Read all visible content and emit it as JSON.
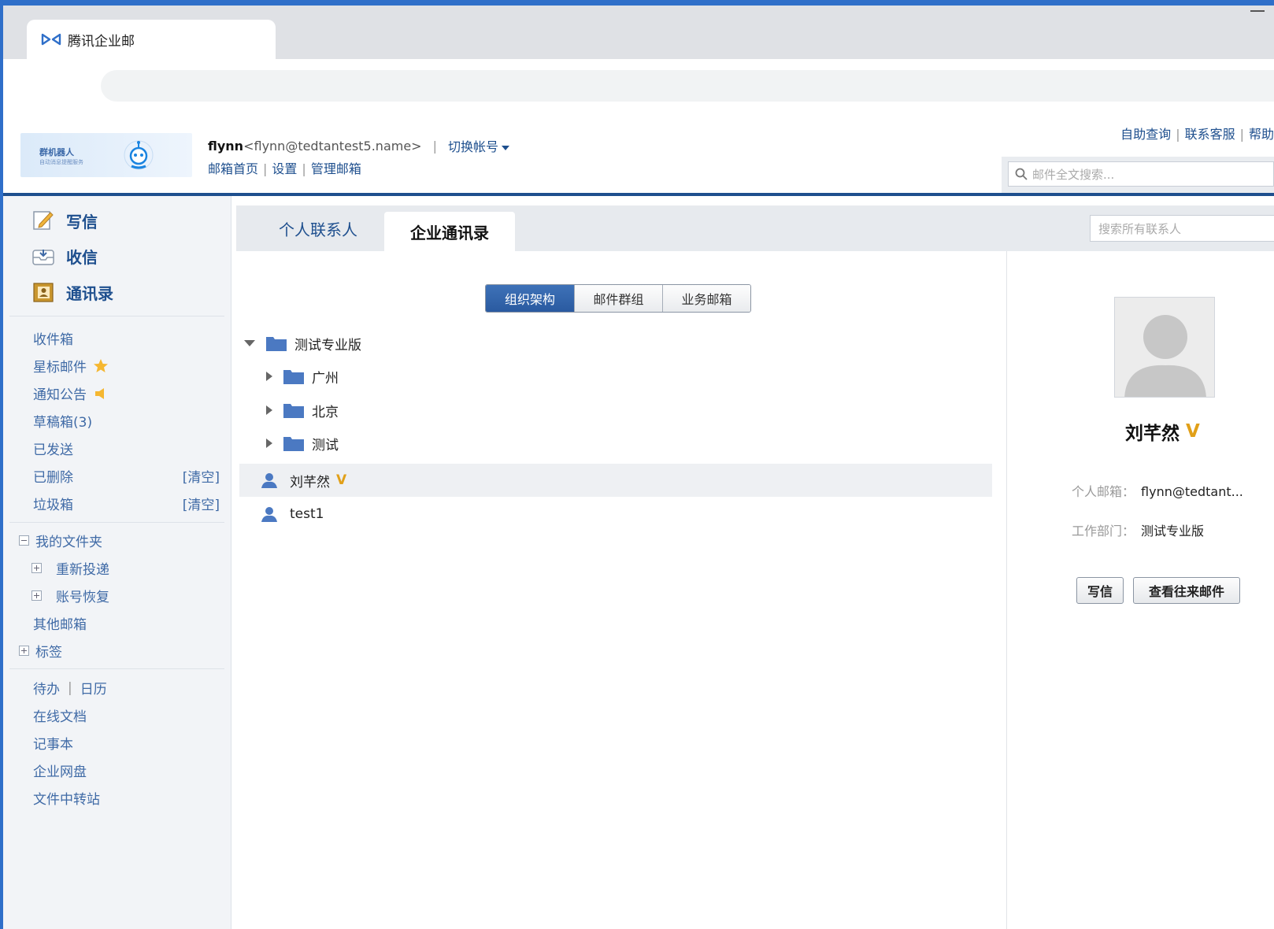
{
  "browser": {
    "tab_title": "腾讯企业邮"
  },
  "header": {
    "banner_title": "群机器人",
    "banner_sub": "自动消息提醒服务",
    "user_name": "flynn",
    "user_email": "<flynn@tedtantest5.name>",
    "separator": "|",
    "switch_account": "切换帐号",
    "links": [
      "邮箱首页",
      "设置",
      "管理邮箱"
    ],
    "top_links": [
      "自助查询",
      "联系客服",
      "帮助"
    ],
    "mail_search_placeholder": "邮件全文搜索..."
  },
  "sidebar": {
    "compose": "写信",
    "inbox_main": "收信",
    "contacts": "通讯录",
    "folders": [
      {
        "label": "收件箱"
      },
      {
        "label": "星标邮件"
      },
      {
        "label": "通知公告"
      },
      {
        "label": "草稿箱(3)"
      },
      {
        "label": "已发送"
      },
      {
        "label": "已删除",
        "extra": "[清空]"
      },
      {
        "label": "垃圾箱",
        "extra": "[清空]"
      }
    ],
    "my_folders": "我的文件夹",
    "my_folder_items": [
      "重新投递",
      "账号恢复"
    ],
    "other_mail": "其他邮箱",
    "tags": "标签",
    "todo": "待办",
    "calendar": "日历",
    "tools": [
      "在线文档",
      "记事本",
      "企业网盘",
      "文件中转站"
    ]
  },
  "main": {
    "tabs": [
      "个人联系人",
      "企业通讯录"
    ],
    "contact_search_placeholder": "搜索所有联系人",
    "segments": [
      "组织架构",
      "邮件群组",
      "业务邮箱"
    ],
    "tree": {
      "root": "测试专业版",
      "folders": [
        "广州",
        "北京",
        "测试"
      ],
      "people": [
        {
          "name": "刘芊然",
          "badge": "V"
        },
        {
          "name": "test1"
        }
      ]
    }
  },
  "detail": {
    "name": "刘芊然",
    "badge": "V",
    "email_label": "个人邮箱：",
    "email_value": "flynn@tedtant...",
    "dept_label": "工作部门：",
    "dept_value": "测试专业版",
    "compose_button": "写信",
    "history_button": "查看往来邮件"
  },
  "colors": {
    "accent": "#1e4f8e",
    "link": "#3f6aa6",
    "badge": "#e1a019",
    "segment_active": "#2a5aa0"
  }
}
